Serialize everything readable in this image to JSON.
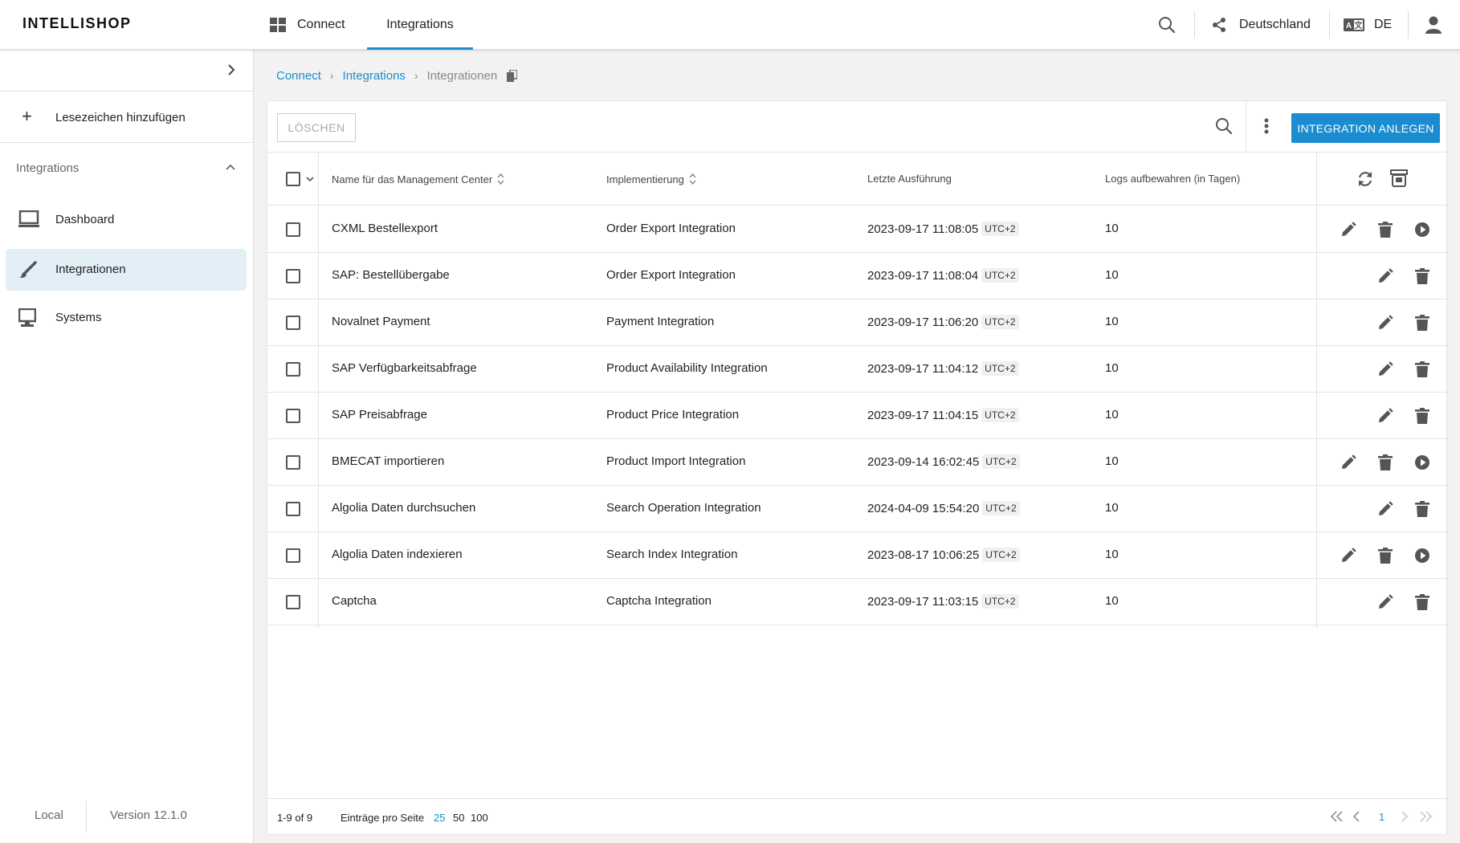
{
  "header": {
    "brand": "INTELLISHOP",
    "tabs": [
      {
        "label": "Connect",
        "icon": "grid-icon"
      },
      {
        "label": "Integrations",
        "active": true
      }
    ],
    "country": "Deutschland",
    "language": "DE"
  },
  "sidebar": {
    "bookmark_label": "Lesezeichen hinzufügen",
    "section_title": "Integrations",
    "items": [
      {
        "label": "Dashboard",
        "icon": "monitor-icon"
      },
      {
        "label": "Integrationen",
        "icon": "brush-icon",
        "active": true
      },
      {
        "label": "Systems",
        "icon": "desktop-icon"
      }
    ],
    "footer": {
      "env": "Local",
      "version": "Version 12.1.0"
    }
  },
  "breadcrumb": {
    "items": [
      "Connect",
      "Integrations"
    ],
    "current": "Integrationen"
  },
  "toolbar": {
    "delete_label": "LÖSCHEN",
    "create_label": "INTEGRATION ANLEGEN"
  },
  "table": {
    "headers": {
      "name": "Name für das Management Center",
      "implementation": "Implementierung",
      "last_run": "Letzte Ausführung",
      "logs": "Logs aufbewahren (in Tagen)"
    },
    "timezone": "UTC+2",
    "rows": [
      {
        "name": "CXML Bestellexport",
        "implementation": "Order Export Integration",
        "last_run": "2023-09-17 11:08:05",
        "logs": "10",
        "runnable": true
      },
      {
        "name": "SAP: Bestellübergabe",
        "implementation": "Order Export Integration",
        "last_run": "2023-09-17 11:08:04",
        "logs": "10",
        "runnable": false
      },
      {
        "name": "Novalnet Payment",
        "implementation": "Payment Integration",
        "last_run": "2023-09-17 11:06:20",
        "logs": "10",
        "runnable": false
      },
      {
        "name": "SAP Verfügbarkeitsabfrage",
        "implementation": "Product Availability Integration",
        "last_run": "2023-09-17 11:04:12",
        "logs": "10",
        "runnable": false
      },
      {
        "name": "SAP Preisabfrage",
        "implementation": "Product Price Integration",
        "last_run": "2023-09-17 11:04:15",
        "logs": "10",
        "runnable": false
      },
      {
        "name": "BMECAT importieren",
        "implementation": "Product Import Integration",
        "last_run": "2023-09-14 16:02:45",
        "logs": "10",
        "runnable": true
      },
      {
        "name": "Algolia Daten durchsuchen",
        "implementation": "Search Operation Integration",
        "last_run": "2024-04-09 15:54:20",
        "logs": "10",
        "runnable": false
      },
      {
        "name": "Algolia Daten indexieren",
        "implementation": "Search Index Integration",
        "last_run": "2023-08-17 10:06:25",
        "logs": "10",
        "runnable": true
      },
      {
        "name": "Captcha",
        "implementation": "Captcha Integration",
        "last_run": "2023-09-17 11:03:15",
        "logs": "10",
        "runnable": false
      }
    ]
  },
  "footer": {
    "range": "1-9 of 9",
    "per_page_label": "Einträge pro Seite",
    "per_page_options": [
      "25",
      "50",
      "100"
    ],
    "per_page_selected": "25",
    "current_page": "1"
  },
  "colors": {
    "accent": "#1a8ccf",
    "active_bg": "#e3eff7",
    "icon": "#555555"
  }
}
